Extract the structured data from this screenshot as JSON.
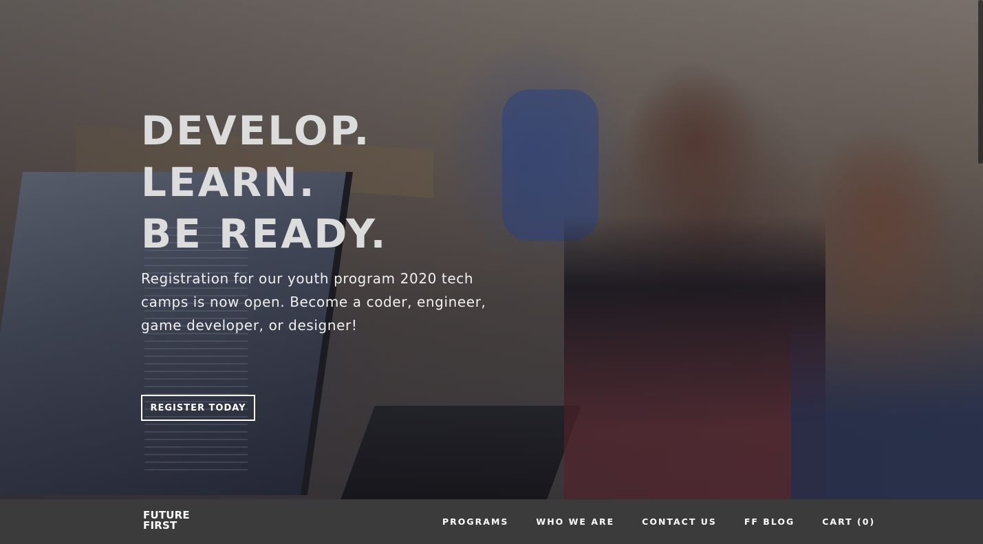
{
  "hero": {
    "headline_lines": [
      "DEVELOP.",
      "LEARN.",
      "BE READY."
    ],
    "subtext": "Registration for our youth program 2020 tech camps is now open. Become a coder, engineer, game developer, or designer!",
    "cta_label": "REGISTER TODAY"
  },
  "logo": {
    "line1": "FUTURE",
    "line2": "FIRST"
  },
  "nav": {
    "items": [
      {
        "label": "PROGRAMS"
      },
      {
        "label": "WHO WE ARE"
      },
      {
        "label": "CONTACT US"
      },
      {
        "label": "FF BLOG"
      },
      {
        "label": "CART (0)"
      }
    ]
  },
  "colors": {
    "navbar": "#3b3b3b",
    "text": "#ffffff",
    "headline": "#dcdcdc"
  }
}
